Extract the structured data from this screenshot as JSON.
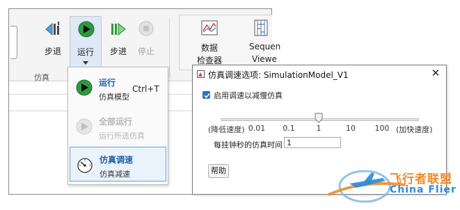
{
  "toolbar": {
    "step_back_label": "步退",
    "run_label": "运行",
    "step_forward_label": "步进",
    "stop_label": "停止",
    "data_inspector_label_1": "数据",
    "data_inspector_label_2": "检查器",
    "sequence_viewer_label_1": "Sequen",
    "sequence_viewer_label_2": "Viewe",
    "section_label": "仿真"
  },
  "run_menu": {
    "items": [
      {
        "title": "运行",
        "subtitle": "仿真模型",
        "shortcut": "Ctrl+T",
        "enabled": true,
        "icon": "play-icon"
      },
      {
        "title": "全部运行",
        "subtitle": "运行所选仿真",
        "enabled": false,
        "icon": "play-icon"
      },
      {
        "title": "仿真调速",
        "subtitle": "仿真减速",
        "enabled": true,
        "selected": true,
        "icon": "speedometer-icon"
      }
    ]
  },
  "dialog": {
    "title": "仿真调速选项: SimulationModel_V1",
    "close_glyph": "✕",
    "checkbox_label": "启用调速以减慢仿真",
    "checkbox_checked": true,
    "slider": {
      "left_label": "(降低速度)",
      "right_label": "(加快速度)",
      "ticks": [
        "0.01",
        "0.1",
        "1",
        "10",
        "100"
      ],
      "value": 1
    },
    "sim_time_label": "每挂钟秒的仿真时间",
    "sim_time_value": "1",
    "help_label": "帮助"
  },
  "watermark": {
    "text_cn": "飞行者联盟",
    "text_en": "China Flier"
  },
  "colors": {
    "accent": "#1f5fa8",
    "run_green": "#2e9a3e",
    "checkbox": "#2f6fc7",
    "watermark_orange": "#f08a2a",
    "watermark_blue": "#2b8ad8"
  }
}
